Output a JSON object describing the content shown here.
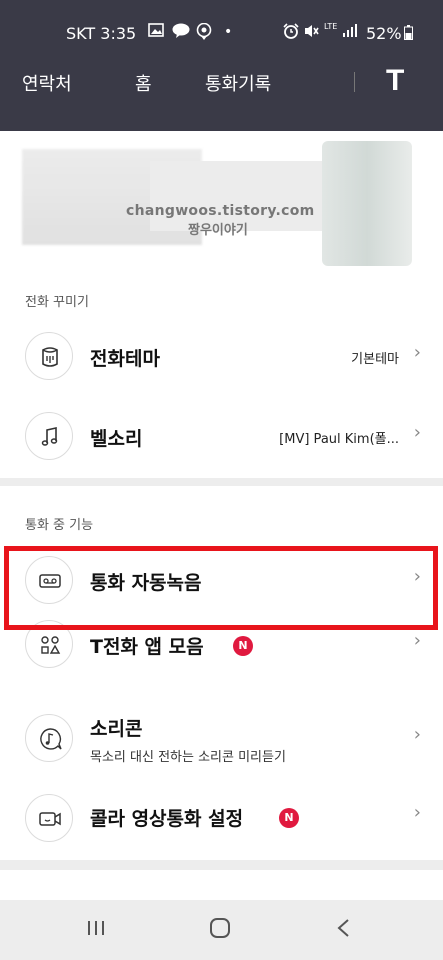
{
  "status_bar": {
    "carrier_time": "SKT 3:35",
    "icons": [
      "image-icon",
      "talk-icon",
      "location-icon",
      "dot-icon",
      "alarm-icon",
      "mute-icon",
      "lte-signal-icon",
      "battery-icon"
    ],
    "dot": "•",
    "lte": "LTE",
    "battery": "52%"
  },
  "nav": {
    "tabs": [
      "연락처",
      "홈",
      "통화기록"
    ],
    "logo": "T"
  },
  "profile": {
    "watermark_url": "changwoos.tistory.com",
    "watermark_name": "짱우이야기"
  },
  "sections": {
    "decorate": {
      "title": "전화 꾸미기",
      "items": [
        {
          "label": "전화테마",
          "value": "기본테마",
          "icon": "theme-bucket-icon"
        },
        {
          "label": "벨소리",
          "value": "[MV] Paul Kim(폴...",
          "icon": "music-note-icon"
        }
      ]
    },
    "in_call": {
      "title": "통화 중 기능",
      "items": [
        {
          "label": "통화 자동녹음",
          "icon": "voicemail-tape-icon"
        },
        {
          "label": "T전화 앱 모음",
          "icon": "app-collection-icon",
          "badge": "N"
        },
        {
          "label": "소리콘",
          "sub": "목소리 대신 전하는 소리콘 미리듣기",
          "icon": "music-chat-icon"
        },
        {
          "label": "콜라 영상통화 설정",
          "icon": "video-call-icon",
          "badge": "N"
        }
      ]
    }
  },
  "chevron": "›",
  "colors": {
    "header_bg": "#3a3a47",
    "highlight_border": "#e8141b",
    "badge_bg": "#e0193f",
    "page_bg": "#ededed"
  }
}
